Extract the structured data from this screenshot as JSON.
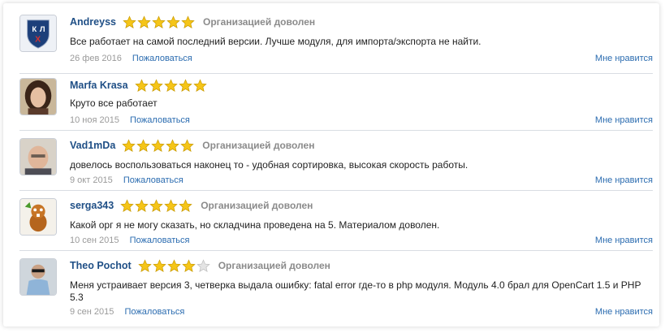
{
  "reviews": [
    {
      "author": "Andreyss",
      "stars": 5,
      "status": "Организацией доволен",
      "text": "Все работает на самой последний версии. Лучше модуля, для импорта/экспорта не найти.",
      "date": "26 фев 2016",
      "complain": "Пожаловаться",
      "like": "Мне нравится",
      "avatar": "khl-logo-avatar"
    },
    {
      "author": "Marfa Krasa",
      "stars": 5,
      "status": "",
      "text": "Круто все работает",
      "date": "10 ноя 2015",
      "complain": "Пожаловаться",
      "like": "Мне нравится",
      "avatar": "woman-photo-avatar"
    },
    {
      "author": "Vad1mDa",
      "stars": 5,
      "status": "Организацией доволен",
      "text": "довелось воспользоваться наконец то - удобная сортировка, высокая скорость работы.",
      "date": "9 окт 2015",
      "complain": "Пожаловаться",
      "like": "Мне нравится",
      "avatar": "man-photo-avatar"
    },
    {
      "author": "serga343",
      "stars": 5,
      "status": "Организацией доволен",
      "text": "Какой орг я не могу сказать, но складчина проведена на 5. Материалом доволен.",
      "date": "10 сен 2015",
      "complain": "Пожаловаться",
      "like": "Мне нравится",
      "avatar": "beaver-cartoon-avatar"
    },
    {
      "author": "Theo Pochot",
      "stars": 4,
      "status": "Организацией доволен",
      "text": "Меня устраивает версия 3, четверка выдала ошибку: fatal error где-то в php модуля. Модуль 4.0 брал для OpenCart 1.5 и PHP 5.3",
      "date": "9 сен 2015",
      "complain": "Пожаловаться",
      "like": "Мне нравится",
      "avatar": "man-sunglasses-avatar"
    }
  ],
  "colors": {
    "author": "#1f4f86",
    "link": "#2b6cb0",
    "star_fill": "#f5c518",
    "star_empty": "#e4e4e4"
  }
}
